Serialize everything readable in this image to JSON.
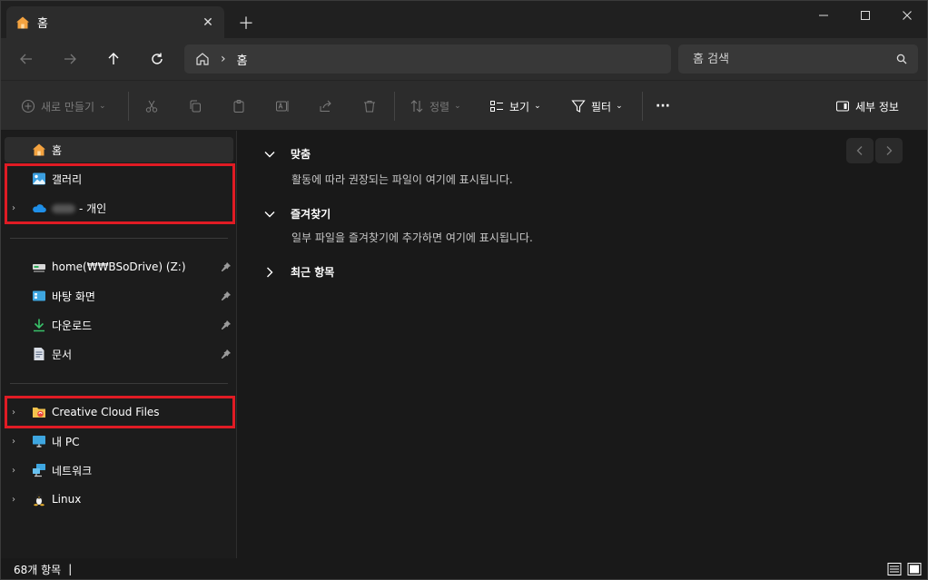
{
  "tab": {
    "title": "홈"
  },
  "address": {
    "crumb": "홈"
  },
  "search": {
    "placeholder": "홈 검색"
  },
  "toolbar": {
    "new_label": "새로 만들기",
    "sort_label": "정렬",
    "view_label": "보기",
    "filter_label": "필터",
    "more_label": "···",
    "details_label": "세부 정보"
  },
  "sidebar": {
    "items": [
      {
        "label": "홈",
        "icon": "home-icon"
      },
      {
        "label": "갤러리",
        "icon": "gallery-icon"
      },
      {
        "label": "- 개인",
        "icon": "onedrive-icon"
      },
      {
        "label": "home(₩₩BSoDrive) (Z:)",
        "icon": "network-drive-icon"
      },
      {
        "label": "바탕 화면",
        "icon": "desktop-icon"
      },
      {
        "label": "다운로드",
        "icon": "download-icon"
      },
      {
        "label": "문서",
        "icon": "documents-icon"
      },
      {
        "label": "Creative Cloud Files",
        "icon": "creative-cloud-folder-icon"
      },
      {
        "label": "내 PC",
        "icon": "this-pc-icon"
      },
      {
        "label": "네트워크",
        "icon": "network-icon"
      },
      {
        "label": "Linux",
        "icon": "linux-icon"
      }
    ]
  },
  "main": {
    "sections": [
      {
        "title": "맞춤",
        "description": "활동에 따라 권장되는 파일이 여기에 표시됩니다."
      },
      {
        "title": "즐겨찾기",
        "description": "일부 파일을 즐겨찾기에 추가하면 여기에 표시됩니다."
      },
      {
        "title": "최근 항목",
        "description": ""
      }
    ]
  },
  "status": {
    "count": "68개 항목",
    "bar": "|"
  },
  "colors": {
    "highlight": "#e01b24",
    "accent": "#f0a030"
  }
}
